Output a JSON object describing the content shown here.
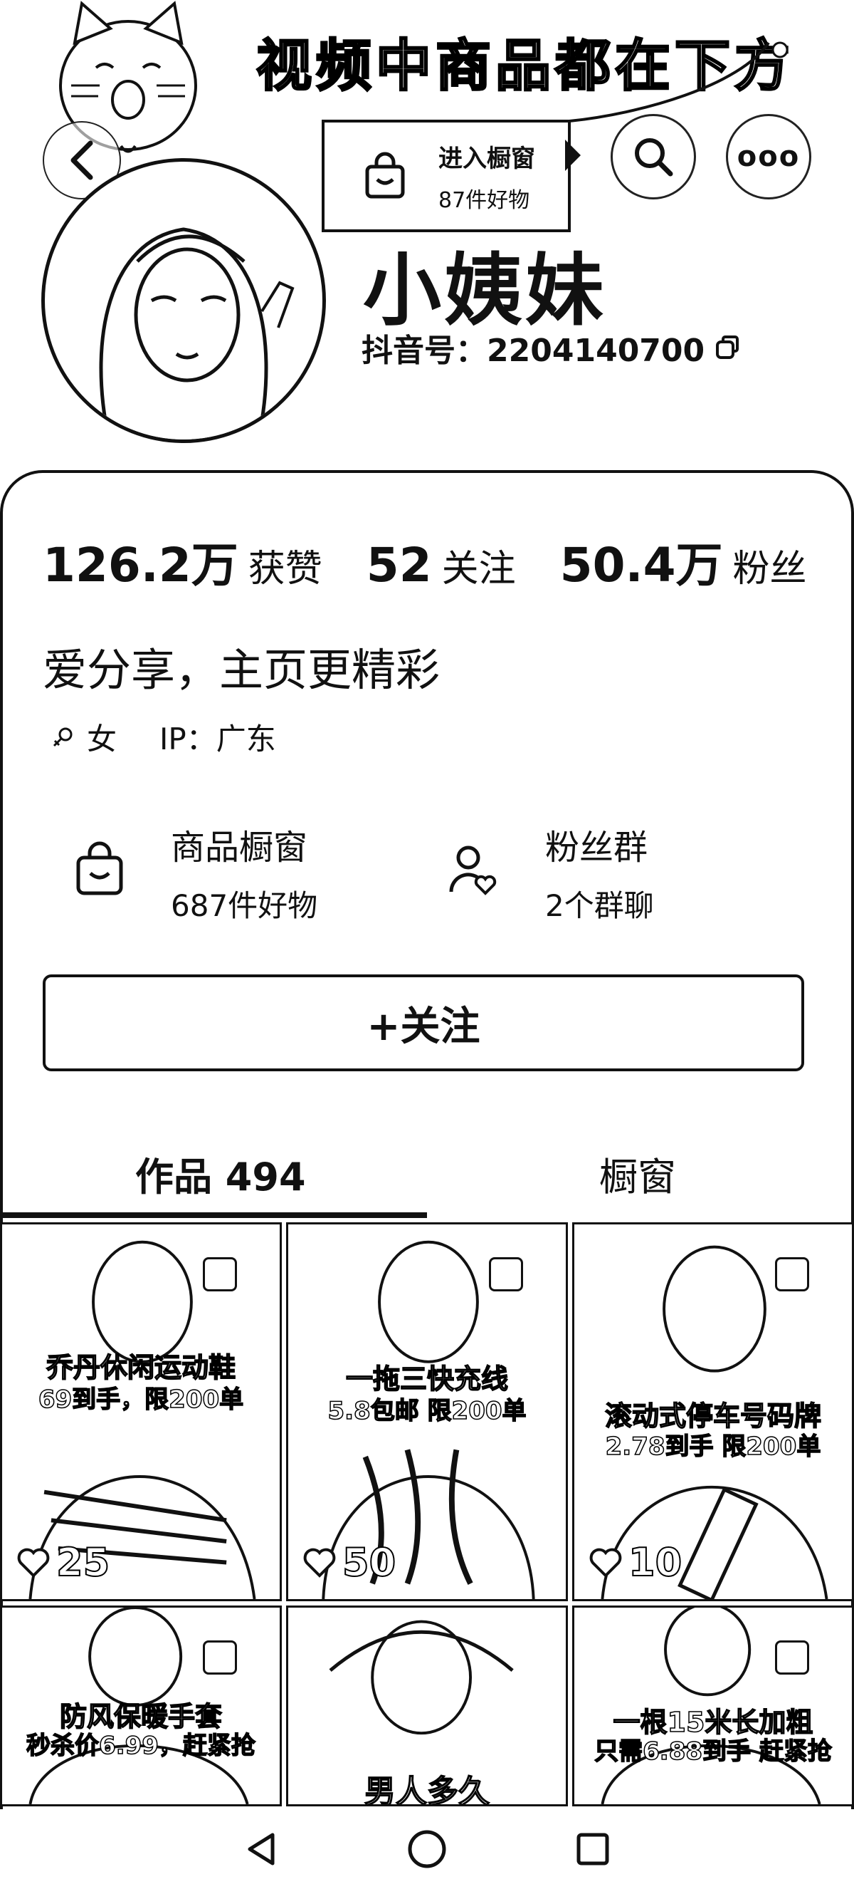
{
  "banner": {
    "text": "视频中商品都在下方"
  },
  "header": {
    "more_label": "ooo"
  },
  "shop_popup": {
    "title": "进入橱窗",
    "subtitle": "87件好物"
  },
  "profile": {
    "nickname": "小姨妹",
    "douyin_id": "抖音号：2204140700"
  },
  "stats": [
    {
      "value": "126.2万",
      "label": "获赞"
    },
    {
      "value": "52",
      "label": "关注"
    },
    {
      "value": "50.4万",
      "label": "粉丝"
    }
  ],
  "signature": "爱分享，主页更精彩",
  "tags": {
    "gender": "女",
    "ip": "IP：广东"
  },
  "features": {
    "shop": {
      "title": "商品橱窗",
      "subtitle": "687件好物"
    },
    "fans": {
      "title": "粉丝群",
      "subtitle": "2个群聊"
    }
  },
  "follow_button": "+关注",
  "tabs": [
    {
      "label": "作品 494",
      "active": true
    },
    {
      "label": "橱窗",
      "active": false
    }
  ],
  "videos": [
    {
      "caption1": "乔丹休闲运动鞋",
      "caption2": "69到手，限200单",
      "likes": "25"
    },
    {
      "caption1": "一拖三快充线",
      "caption2": "5.8包邮 限200单",
      "likes": "50"
    },
    {
      "caption1": "滚动式停车号码牌",
      "caption2": "2.78到手 限200单",
      "likes": "10"
    },
    {
      "caption1": "防风保暖手套",
      "caption2": "秒杀价6.99，赶紧抢",
      "likes": ""
    },
    {
      "caption1": "男人多久",
      "caption2": "",
      "likes": ""
    },
    {
      "caption1": "一根15米长加粗",
      "caption2": "只需6.88到手 赶紧抢",
      "likes": ""
    }
  ],
  "icons": {
    "back": "chevron-left-icon",
    "search": "search-icon",
    "shop": "shopping-bag-icon",
    "fans": "user-heart-icon",
    "copy": "copy-icon",
    "like": "heart-icon"
  },
  "colors": {
    "ink": "#111111",
    "background": "#ffffff"
  }
}
